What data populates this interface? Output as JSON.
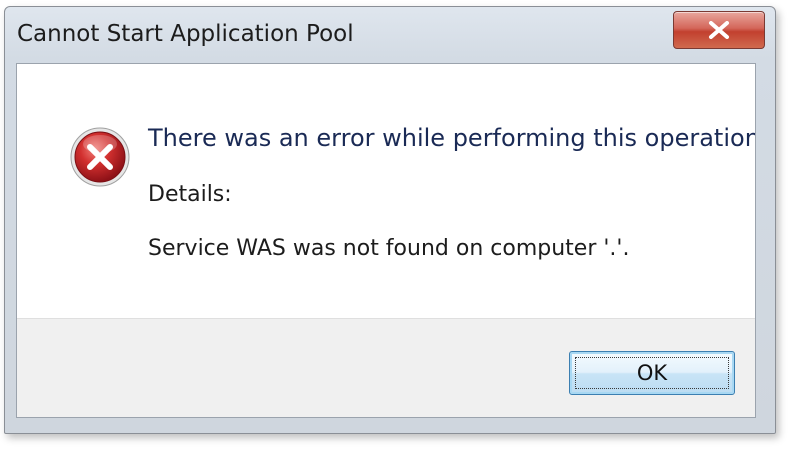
{
  "window": {
    "title": "Cannot Start Application Pool",
    "close_symbol": "X"
  },
  "icons": {
    "error": "error-icon",
    "close": "close-icon"
  },
  "message": {
    "main": "There was an error while performing this operation.",
    "details_label": "Details:",
    "details_text": "Service WAS was not found on computer '.'."
  },
  "buttons": {
    "ok_label": "OK"
  },
  "colors": {
    "error_red": "#c0242a",
    "close_red": "#c2402f",
    "focus_blue": "#3c7fb1"
  }
}
